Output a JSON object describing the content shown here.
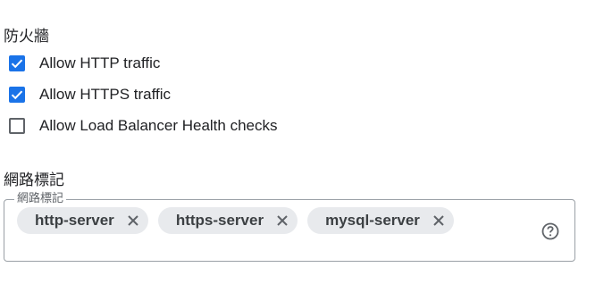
{
  "firewall": {
    "title": "防火牆",
    "options": [
      {
        "label": "Allow HTTP traffic",
        "checked": true
      },
      {
        "label": "Allow HTTPS traffic",
        "checked": true
      },
      {
        "label": "Allow Load Balancer Health checks",
        "checked": false
      }
    ]
  },
  "network_tags": {
    "title": "網路標記",
    "field_label": "網路標記",
    "tags": [
      "http-server",
      "https-server",
      "mysql-server"
    ],
    "help_icon": "help-circle-icon",
    "remove_icon": "close-icon"
  },
  "colors": {
    "accent": "#1a73e8",
    "chip_background": "#e8eaed"
  }
}
